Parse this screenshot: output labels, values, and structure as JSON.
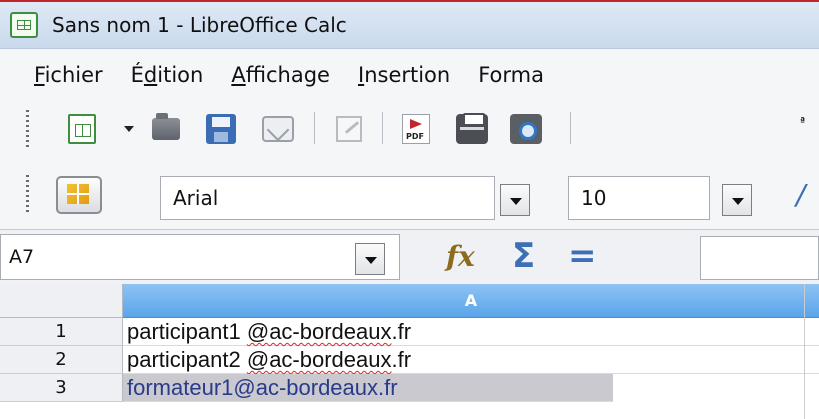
{
  "window": {
    "title": "Sans nom 1 - LibreOffice Calc",
    "app_icon": "calc-spreadsheet-icon"
  },
  "menu": {
    "items": [
      {
        "label": "Fichier",
        "accel": "F"
      },
      {
        "label": "Édition",
        "accel": "d"
      },
      {
        "label": "Affichage",
        "accel": "A"
      },
      {
        "label": "Insertion",
        "accel": "I"
      },
      {
        "label": "Forma",
        "accel": ""
      }
    ]
  },
  "standard_toolbar": {
    "icons": [
      "new-spreadsheet-icon",
      "dropdown-arrow-icon",
      "open-folder-icon",
      "save-icon",
      "email-document-icon",
      "edit-file-icon",
      "export-pdf-icon",
      "print-icon",
      "print-preview-icon",
      "spellcheck-icon"
    ],
    "pdf_label": "PDF"
  },
  "format_toolbar": {
    "font_name": "Arial",
    "font_size": "10"
  },
  "formula_bar": {
    "name_box": "A7",
    "fx_label": "fx",
    "sigma_label": "Σ",
    "equal_label": "="
  },
  "sheet": {
    "column_headers": [
      "A"
    ],
    "rows": [
      {
        "number": "1",
        "prefix": "participant1 ",
        "underlined": "@ac-bordeaux",
        "suffix": ".fr",
        "selected": false
      },
      {
        "number": "2",
        "prefix": "participant2 ",
        "underlined": "@ac-bordeaux",
        "suffix": ".fr",
        "selected": false
      },
      {
        "number": "3",
        "prefix": "formateur1@ac-bordeaux.fr",
        "underlined": "",
        "suffix": "",
        "selected": true
      }
    ]
  },
  "colors": {
    "column_header_fill": "#5aa5ea",
    "selection_fill": "#c9c9cf",
    "spell_underline": "#d22a2a"
  }
}
